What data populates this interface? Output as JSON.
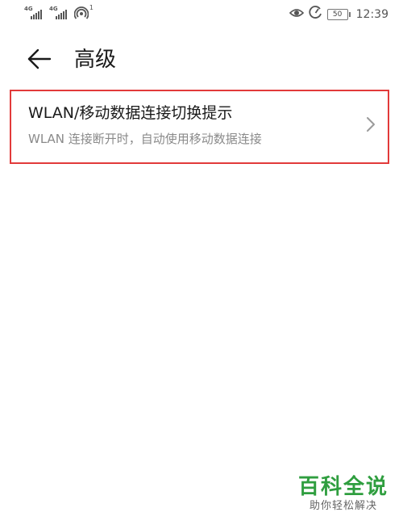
{
  "status_bar": {
    "sim1_tag": "4G",
    "sim2_tag": "4G",
    "hotspot_badge": "1",
    "battery": "50",
    "time": "12:39",
    "icons": [
      "signal-icon",
      "signal-icon",
      "hotspot-icon",
      "eye-comfort-icon",
      "data-saver-icon",
      "battery-icon"
    ]
  },
  "header": {
    "back_icon": "arrow-left-icon",
    "title": "高级"
  },
  "settings": {
    "items": [
      {
        "title": "WLAN/移动数据连接切换提示",
        "subtitle": "WLAN 连接断开时，自动使用移动数据连接",
        "icon": "chevron-right-icon"
      }
    ],
    "highlight_color": "#e23a3a"
  },
  "watermark": {
    "title": "百科全说",
    "subtitle": "助你轻松解决",
    "color": "#2f9e3f"
  }
}
